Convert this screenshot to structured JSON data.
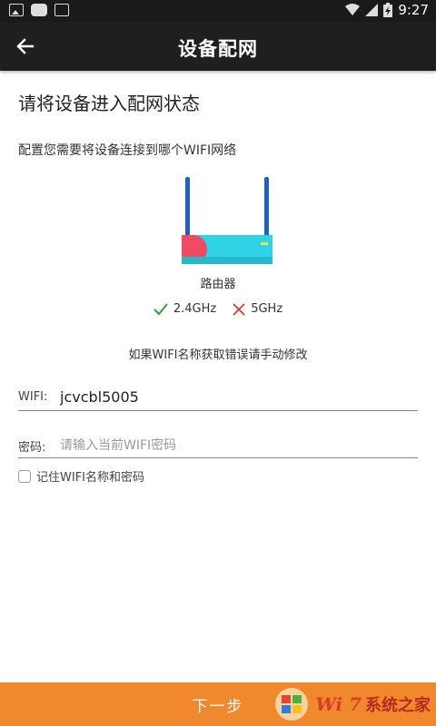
{
  "status_bar": {
    "time": "9:27"
  },
  "app_bar": {
    "title": "设备配网"
  },
  "main": {
    "headline": "请将设备进入配网状态",
    "subline": "配置您需要将设备连接到哪个WIFI网络",
    "router_label": "路由器",
    "bands": [
      {
        "label": "2.4GHz",
        "supported": true
      },
      {
        "label": "5GHz",
        "supported": false
      }
    ],
    "hint": "如果WIFI名称获取错误请手动修改"
  },
  "form": {
    "wifi_label": "WIFI:",
    "wifi_value": "jcvcbl5005",
    "password_label": "密码:",
    "password_placeholder": "请输入当前WIFI密码",
    "remember_label": "记住WIFI名称和密码"
  },
  "footer": {
    "next_label": "下一步",
    "watermark_text": "Wi 7",
    "watermark_cn": "系统之家"
  },
  "colors": {
    "accent": "#f0892e",
    "check": "#2e9e3e",
    "cross": "#d93a2f",
    "router_body": "#2fd3e6",
    "router_end": "#ef4c64",
    "antenna": "#1f5fc9"
  }
}
